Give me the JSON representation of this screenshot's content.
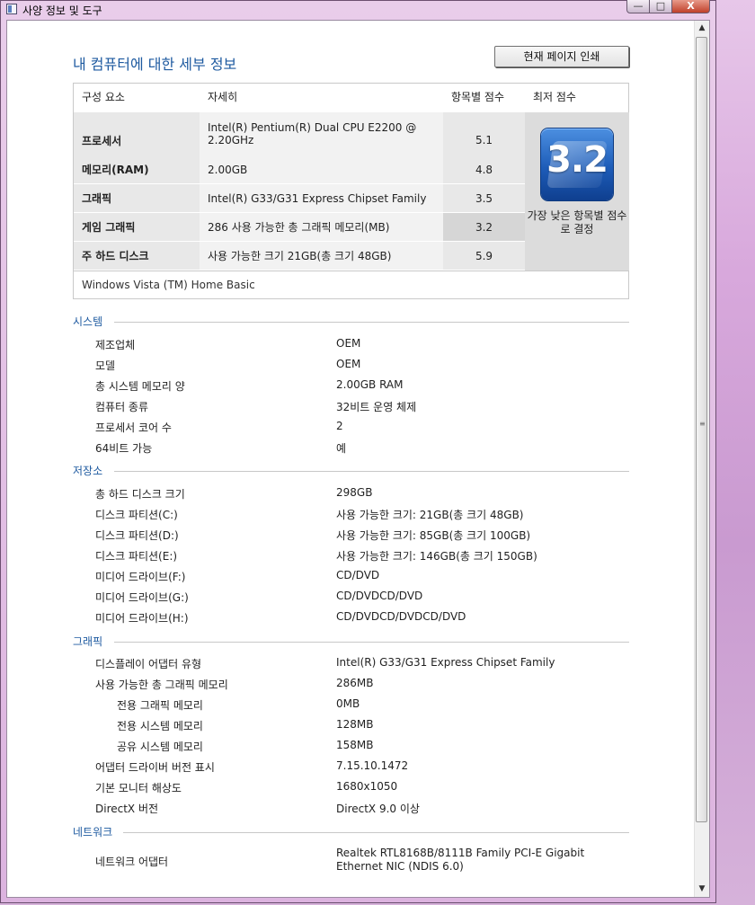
{
  "window": {
    "title": "사양 정보 및 도구",
    "buttons": {
      "minimize": "—",
      "maximize": "□",
      "close": "X"
    }
  },
  "page": {
    "title": "내 컴퓨터에 대한 세부 정보",
    "print_button": "현재 페이지 인쇄"
  },
  "score_table": {
    "headers": [
      "구성 요소",
      "자세히",
      "항목별 점수",
      "최저 점수"
    ],
    "rows": [
      {
        "component": "프로세서",
        "detail": "Intel(R) Pentium(R) Dual CPU E2200 @ 2.20GHz",
        "score": "5.1"
      },
      {
        "component": "메모리(RAM)",
        "detail": "2.00GB",
        "score": "4.8"
      },
      {
        "component": "그래픽",
        "detail": "Intel(R) G33/G31 Express Chipset Family",
        "score": "3.5"
      },
      {
        "component": "게임 그래픽",
        "detail": "286 사용 가능한 총 그래픽 메모리(MB)",
        "score": "3.2"
      },
      {
        "component": "주 하드 디스크",
        "detail": "사용 가능한 크기 21GB(총 크기 48GB)",
        "score": "5.9"
      }
    ],
    "base_score": "3.2",
    "base_caption": "가장 낮은 항목별 점수로 결정",
    "os_name": "Windows Vista (TM) Home Basic"
  },
  "sections": [
    {
      "title": "시스템",
      "items": [
        {
          "label": "제조업체",
          "value": "OEM"
        },
        {
          "label": "모델",
          "value": "OEM"
        },
        {
          "label": "총 시스템 메모리 양",
          "value": "2.00GB RAM"
        },
        {
          "label": "컴퓨터 종류",
          "value": "32비트 운영 체제"
        },
        {
          "label": "프로세서 코어 수",
          "value": "2"
        },
        {
          "label": "64비트 가능",
          "value": "예"
        }
      ]
    },
    {
      "title": "저장소",
      "items": [
        {
          "label": "총 하드 디스크 크기",
          "value": "298GB"
        },
        {
          "label": "디스크 파티션(C:)",
          "value": "사용 가능한 크기: 21GB(총 크기 48GB)"
        },
        {
          "label": "디스크 파티션(D:)",
          "value": "사용 가능한 크기: 85GB(총 크기 100GB)"
        },
        {
          "label": "디스크 파티션(E:)",
          "value": "사용 가능한 크기: 146GB(총 크기 150GB)"
        },
        {
          "label": "미디어 드라이브(F:)",
          "value": "CD/DVD"
        },
        {
          "label": "미디어 드라이브(G:)",
          "value": "CD/DVDCD/DVD"
        },
        {
          "label": "미디어 드라이브(H:)",
          "value": "CD/DVDCD/DVDCD/DVD"
        }
      ]
    },
    {
      "title": "그래픽",
      "items": [
        {
          "label": "디스플레이 어댑터 유형",
          "value": "Intel(R) G33/G31 Express Chipset Family"
        },
        {
          "label": "사용 가능한 총 그래픽 메모리",
          "value": "286MB"
        },
        {
          "label": "전용 그래픽 메모리",
          "value": "0MB"
        },
        {
          "label": "전용 시스템 메모리",
          "value": "128MB"
        },
        {
          "label": "공유 시스템 메모리",
          "value": "158MB"
        },
        {
          "label": "어댑터 드라이버 버전 표시",
          "value": "7.15.10.1472"
        },
        {
          "label": "기본 모니터 해상도",
          "value": "1680x1050"
        },
        {
          "label": "DirectX 버전",
          "value": "DirectX 9.0 이상"
        }
      ]
    },
    {
      "title": "네트워크",
      "items": [
        {
          "label": "네트워크 어댑터",
          "value": "Realtek RTL8168B/8111B Family PCI-E Gigabit Ethernet NIC (NDIS 6.0)"
        }
      ]
    }
  ],
  "colors": {
    "accent": "#1e5aa0",
    "badge": "#1d5cb8"
  }
}
